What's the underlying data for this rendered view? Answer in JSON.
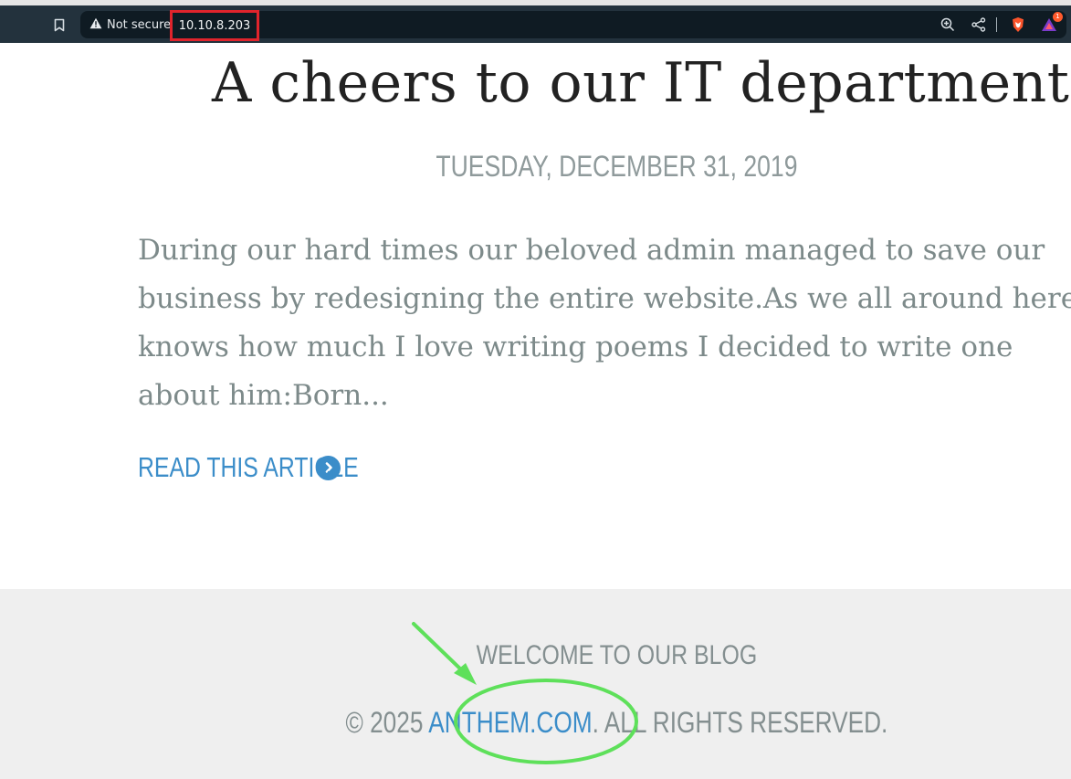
{
  "browser": {
    "security_label": "Not secure",
    "url": "10.10.8.203",
    "notification_count": "1",
    "icons": [
      "bookmark-icon",
      "warning-icon",
      "zoom-icon",
      "share-icon",
      "brave-shield-icon",
      "brave-rewards-icon"
    ]
  },
  "post": {
    "title": "A cheers to our IT department",
    "date": "TUESDAY, DECEMBER 31, 2019",
    "excerpt": "During our hard times our beloved admin managed to save our business by redesigning the entire website.As we all around here knows how much I love writing poems I decided to write one about him:Born...",
    "read_more": "READ THIS ARTICLE"
  },
  "footer": {
    "title": "WELCOME TO OUR BLOG",
    "copyright_prefix": "© 2025 ",
    "site_link": "ANTHEM.COM",
    "copyright_suffix": ". ALL RIGHTS RESERVED."
  },
  "colors": {
    "accent": "#3b8dc9",
    "highlight_box": "#e0242c",
    "annotation_green": "#5ee05a",
    "toolbar": "#23323d",
    "footer_bg": "#efefef"
  }
}
